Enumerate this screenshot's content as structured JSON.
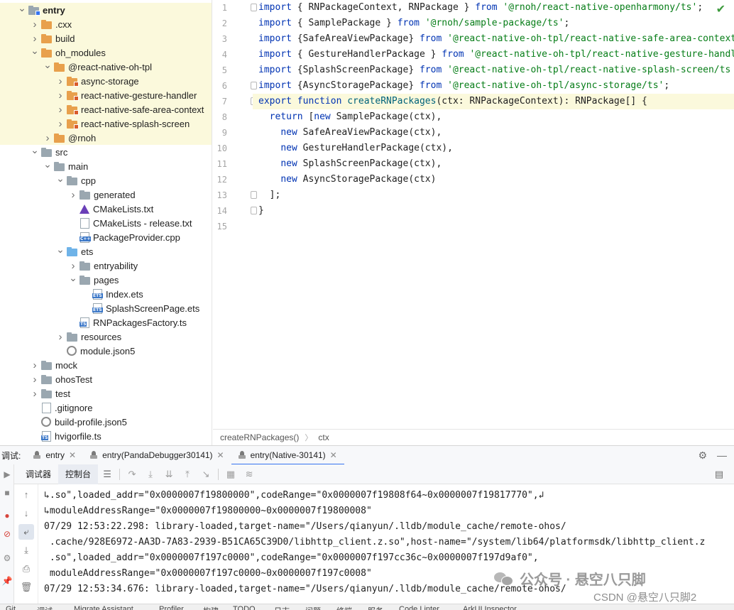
{
  "tree": {
    "rows": [
      {
        "label": "entry",
        "arrow": "down",
        "icon": "folder-module",
        "bold": true,
        "depth": 1,
        "hl": true
      },
      {
        "label": ".cxx",
        "arrow": "right",
        "icon": "folder-orange",
        "depth": 2,
        "hl": true
      },
      {
        "label": "build",
        "arrow": "right",
        "icon": "folder-orange",
        "depth": 2,
        "hl": true
      },
      {
        "label": "oh_modules",
        "arrow": "down",
        "icon": "folder-orange",
        "depth": 2,
        "hl": true
      },
      {
        "label": "@react-native-oh-tpl",
        "arrow": "down",
        "icon": "folder-orange",
        "depth": 3,
        "hl": true
      },
      {
        "label": "async-storage",
        "arrow": "right",
        "icon": "folder-package",
        "depth": 4,
        "hl": true
      },
      {
        "label": "react-native-gesture-handler",
        "arrow": "right",
        "icon": "folder-package",
        "depth": 4,
        "hl": true
      },
      {
        "label": "react-native-safe-area-context",
        "arrow": "right",
        "icon": "folder-package",
        "depth": 4,
        "hl": true
      },
      {
        "label": "react-native-splash-screen",
        "arrow": "right",
        "icon": "folder-package",
        "depth": 4,
        "hl": true
      },
      {
        "label": "@rnoh",
        "arrow": "right",
        "icon": "folder-orange",
        "depth": 3,
        "hl": true
      },
      {
        "label": "src",
        "arrow": "down",
        "icon": "folder",
        "depth": 2
      },
      {
        "label": "main",
        "arrow": "down",
        "icon": "folder",
        "depth": 3
      },
      {
        "label": "cpp",
        "arrow": "down",
        "icon": "folder",
        "depth": 4
      },
      {
        "label": "generated",
        "arrow": "right",
        "icon": "folder",
        "depth": 5
      },
      {
        "label": "CMakeLists.txt",
        "arrow": "none",
        "icon": "cmake",
        "depth": 5
      },
      {
        "label": "CMakeLists - release.txt",
        "arrow": "none",
        "icon": "text-file",
        "depth": 5
      },
      {
        "label": "PackageProvider.cpp",
        "arrow": "none",
        "icon": "cpp-file",
        "depth": 5
      },
      {
        "label": "ets",
        "arrow": "down",
        "icon": "folder-blue",
        "depth": 4
      },
      {
        "label": "entryability",
        "arrow": "right",
        "icon": "folder",
        "depth": 5
      },
      {
        "label": "pages",
        "arrow": "down",
        "icon": "folder",
        "depth": 5
      },
      {
        "label": "Index.ets",
        "arrow": "none",
        "icon": "ets-file",
        "depth": 6
      },
      {
        "label": "SplashScreenPage.ets",
        "arrow": "none",
        "icon": "ets-file",
        "depth": 6
      },
      {
        "label": "RNPackagesFactory.ts",
        "arrow": "none",
        "icon": "ts-file",
        "depth": 5
      },
      {
        "label": "resources",
        "arrow": "right",
        "icon": "folder",
        "depth": 4
      },
      {
        "label": "module.json5",
        "arrow": "none",
        "icon": "json-file",
        "depth": 4
      },
      {
        "label": "mock",
        "arrow": "right",
        "icon": "folder",
        "depth": 2
      },
      {
        "label": "ohosTest",
        "arrow": "right",
        "icon": "folder",
        "depth": 2
      },
      {
        "label": "test",
        "arrow": "right",
        "icon": "folder",
        "depth": 2
      },
      {
        "label": ".gitignore",
        "arrow": "none",
        "icon": "gitignore-file",
        "depth": 2
      },
      {
        "label": "build-profile.json5",
        "arrow": "none",
        "icon": "json-file",
        "depth": 2
      },
      {
        "label": "hvigorfile.ts",
        "arrow": "none",
        "icon": "ts-file",
        "depth": 2
      }
    ]
  },
  "editor": {
    "line_numbers": [
      "1",
      "2",
      "3",
      "4",
      "5",
      "6",
      "7",
      "8",
      "9",
      "10",
      "11",
      "12",
      "13",
      "14",
      "15"
    ],
    "current_line": 7,
    "lines": [
      [
        [
          "kw",
          "import"
        ],
        [
          "pl",
          " { RNPackageContext, RNPackage } "
        ],
        [
          "kw",
          "from"
        ],
        [
          "pl",
          " "
        ],
        [
          "st",
          "'@rnoh/react-native-openharmony/ts'"
        ],
        [
          "pl",
          ";"
        ]
      ],
      [
        [
          "kw",
          "import"
        ],
        [
          "pl",
          " { SamplePackage } "
        ],
        [
          "kw",
          "from"
        ],
        [
          "pl",
          " "
        ],
        [
          "st",
          "'@rnoh/sample-package/ts'"
        ],
        [
          "pl",
          ";"
        ]
      ],
      [
        [
          "kw",
          "import"
        ],
        [
          "pl",
          " {SafeAreaViewPackage} "
        ],
        [
          "kw",
          "from"
        ],
        [
          "pl",
          " "
        ],
        [
          "st",
          "'@react-native-oh-tpl/react-native-safe-area-context"
        ]
      ],
      [
        [
          "kw",
          "import"
        ],
        [
          "pl",
          " { GestureHandlerPackage } "
        ],
        [
          "kw",
          "from"
        ],
        [
          "pl",
          " "
        ],
        [
          "st",
          "'@react-native-oh-tpl/react-native-gesture-handl"
        ]
      ],
      [
        [
          "kw",
          "import"
        ],
        [
          "pl",
          " {SplashScreenPackage} "
        ],
        [
          "kw",
          "from"
        ],
        [
          "pl",
          " "
        ],
        [
          "st",
          "'@react-native-oh-tpl/react-native-splash-screen/ts"
        ]
      ],
      [
        [
          "kw",
          "import"
        ],
        [
          "pl",
          " {AsyncStoragePackage} "
        ],
        [
          "kw",
          "from"
        ],
        [
          "pl",
          " "
        ],
        [
          "st",
          "'@react-native-oh-tpl/async-storage/ts'"
        ],
        [
          "pl",
          ";"
        ]
      ],
      [
        [
          "kw",
          "export function"
        ],
        [
          "pl",
          " "
        ],
        [
          "fn",
          "createRNPackages"
        ],
        [
          "pl",
          "(ctx: RNPackageContext): RNPackage[] {"
        ]
      ],
      [
        [
          "pl",
          "  "
        ],
        [
          "kw",
          "return"
        ],
        [
          "pl",
          " ["
        ],
        [
          "kw",
          "new"
        ],
        [
          "pl",
          " SamplePackage(ctx),"
        ]
      ],
      [
        [
          "pl",
          "    "
        ],
        [
          "kw",
          "new"
        ],
        [
          "pl",
          " SafeAreaViewPackage(ctx),"
        ]
      ],
      [
        [
          "pl",
          "    "
        ],
        [
          "kw",
          "new"
        ],
        [
          "pl",
          " GestureHandlerPackage(ctx),"
        ]
      ],
      [
        [
          "pl",
          "    "
        ],
        [
          "kw",
          "new"
        ],
        [
          "pl",
          " SplashScreenPackage(ctx),"
        ]
      ],
      [
        [
          "pl",
          "    "
        ],
        [
          "kw",
          "new"
        ],
        [
          "pl",
          " AsyncStoragePackage(ctx)"
        ]
      ],
      [
        [
          "pl",
          "  ];"
        ]
      ],
      [
        [
          "pl",
          "}"
        ]
      ],
      [
        [
          "pl",
          ""
        ]
      ]
    ],
    "breadcrumb": [
      "createRNPackages()",
      "ctx"
    ]
  },
  "debug": {
    "label": "调试:",
    "tabs": [
      {
        "label": "entry",
        "active": false
      },
      {
        "label": "entry(PandaDebugger30141)",
        "active": false
      },
      {
        "label": "entry(Native-30141)",
        "active": true
      }
    ],
    "subtabs": [
      "调试器",
      "控制台"
    ],
    "active_subtab": 1
  },
  "console": {
    "lines": [
      "↳.so\",loaded_addr=\"0x0000007f19800000\",codeRange=\"0x0000007f19808f64~0x0000007f19817770\",↲",
      "↳moduleAddressRange=\"0x0000007f19800000~0x0000007f19800008\"",
      "07/29 12:53:22.298: library-loaded,target-name=\"/Users/qianyun/.lldb/module_cache/remote-ohos/",
      " .cache/928E6972-AA3D-7A83-2939-B51CA65C39D0/libhttp_client.z.so\",host-name=\"/system/lib64/platformsdk/libhttp_client.z",
      " .so\",loaded_addr=\"0x0000007f197c0000\",codeRange=\"0x0000007f197cc36c~0x0000007f197d9af0\",",
      " moduleAddressRange=\"0x0000007f197c0000~0x0000007f197c0008\"",
      "07/29 12:53:34.676: library-loaded,target-name=\"/Users/qianyun/.lldb/module_cache/remote-ohos/"
    ]
  },
  "watermark": {
    "wechat": "公众号 · 悬空八只脚",
    "csdn": "CSDN @悬空八只脚2"
  },
  "statusbar": {
    "items": [
      "Git",
      "调试",
      "Migrate Assistant",
      "Profiler",
      "构建",
      "TODO",
      "日志",
      "问题",
      "终端",
      "服务",
      "Code Linter",
      "ArkUI Inspector"
    ]
  },
  "colors": {
    "keyword": "#0033b3",
    "string": "#067d17",
    "function": "#00627a",
    "highlight_row": "#fbf9dc",
    "active_tab_underline": "#3574f0"
  }
}
